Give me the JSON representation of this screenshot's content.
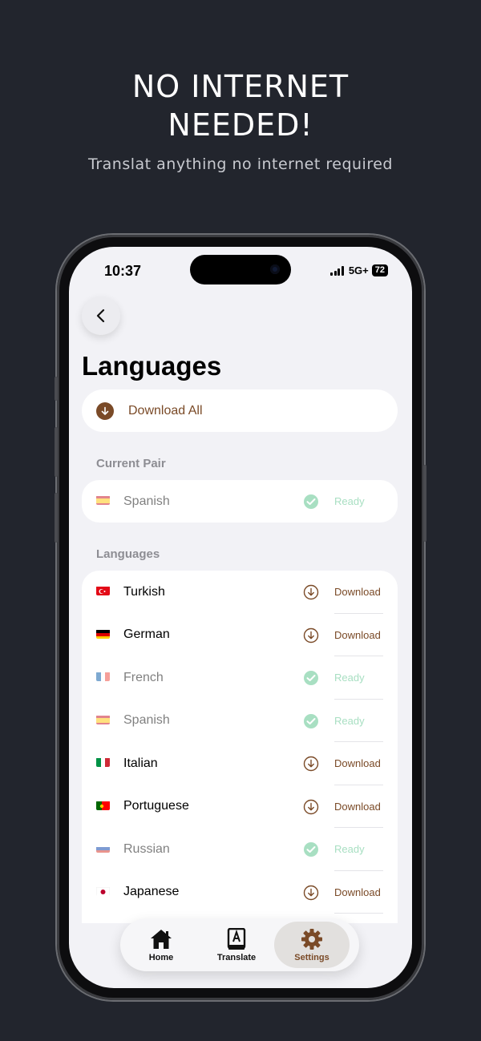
{
  "promo": {
    "title_line1": "NO INTERNET",
    "title_line2": "NEEDED!",
    "subtitle": "Translat anything no internet required"
  },
  "status_bar": {
    "time": "10:37",
    "network": "5G+",
    "battery": "72"
  },
  "page": {
    "title": "Languages",
    "download_all_label": "Download All"
  },
  "current_pair": {
    "header": "Current Pair",
    "language": {
      "name": "Spanish",
      "flag": "es-flag",
      "status": "Ready"
    }
  },
  "languages": {
    "header": "Languages",
    "items": [
      {
        "name": "Turkish",
        "flag": "tr-flag",
        "status": "Download"
      },
      {
        "name": "German",
        "flag": "de-flag",
        "status": "Download"
      },
      {
        "name": "French",
        "flag": "fr-flag",
        "status": "Ready"
      },
      {
        "name": "Spanish",
        "flag": "es-flag",
        "status": "Ready"
      },
      {
        "name": "Italian",
        "flag": "it-flag",
        "status": "Download"
      },
      {
        "name": "Portuguese",
        "flag": "pt-flag",
        "status": "Download"
      },
      {
        "name": "Russian",
        "flag": "ru-flag",
        "status": "Ready"
      },
      {
        "name": "Japanese",
        "flag": "jp-flag",
        "status": "Download"
      }
    ]
  },
  "tabbar": {
    "tabs": [
      {
        "label": "Home",
        "icon": "home-icon"
      },
      {
        "label": "Translate",
        "icon": "dictionary-icon"
      },
      {
        "label": "Settings",
        "icon": "gear-icon",
        "active": true
      }
    ]
  },
  "colors": {
    "background": "#22252d",
    "accent_brown": "#7a4a27",
    "ready_green": "#a8dfc2",
    "screen_bg": "#f2f2f6"
  }
}
